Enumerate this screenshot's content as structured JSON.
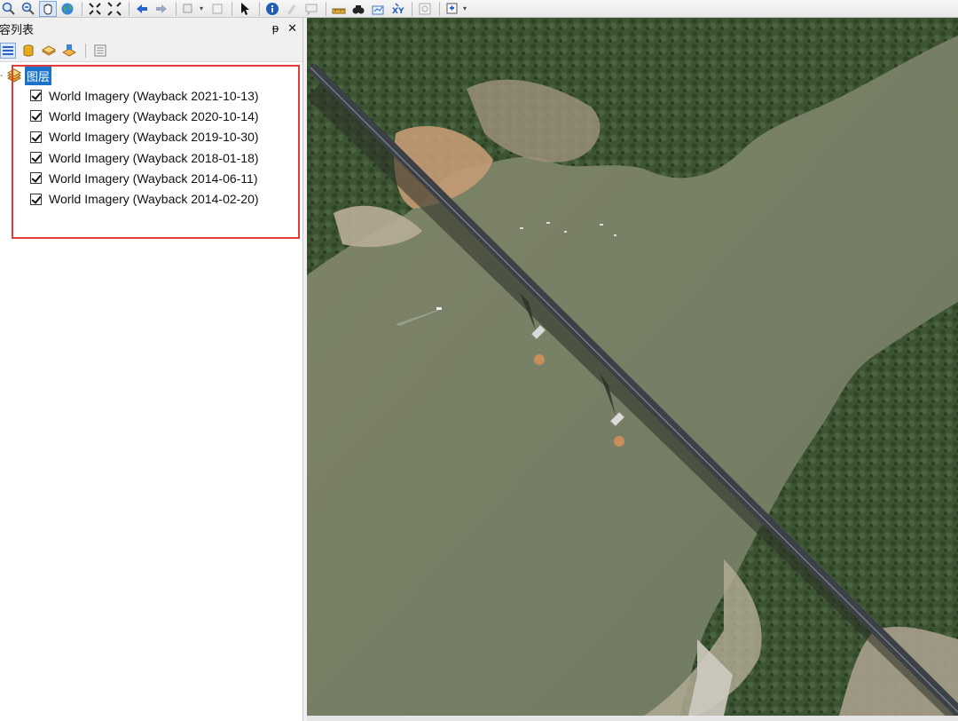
{
  "toc": {
    "title": "容列表",
    "pin_symbol": "ᵽ",
    "close_symbol": "✕",
    "group_label": "图层",
    "layers": [
      {
        "label": "World Imagery (Wayback 2021-10-13)",
        "checked": true
      },
      {
        "label": "World Imagery (Wayback 2020-10-14)",
        "checked": true
      },
      {
        "label": "World Imagery (Wayback 2019-10-30)",
        "checked": true
      },
      {
        "label": "World Imagery (Wayback 2018-01-18)",
        "checked": true
      },
      {
        "label": "World Imagery (Wayback 2014-06-11)",
        "checked": true
      },
      {
        "label": "World Imagery (Wayback 2014-02-20)",
        "checked": true
      }
    ]
  },
  "toolbar": {
    "icons": [
      "zoom-out-icon",
      "pan-hand-icon",
      "globe-icon",
      "full-extent-icon",
      "back-arrow-icon",
      "forward-arrow-icon",
      "select-arrow-icon",
      "identify-icon",
      "measure-icon",
      "find-icon",
      "xy-icon"
    ]
  },
  "colors": {
    "highlight_border": "#e33a3a",
    "selected_group_bg": "#1a73c8",
    "water": "#7c826a",
    "vegetation": "#3b5230"
  }
}
